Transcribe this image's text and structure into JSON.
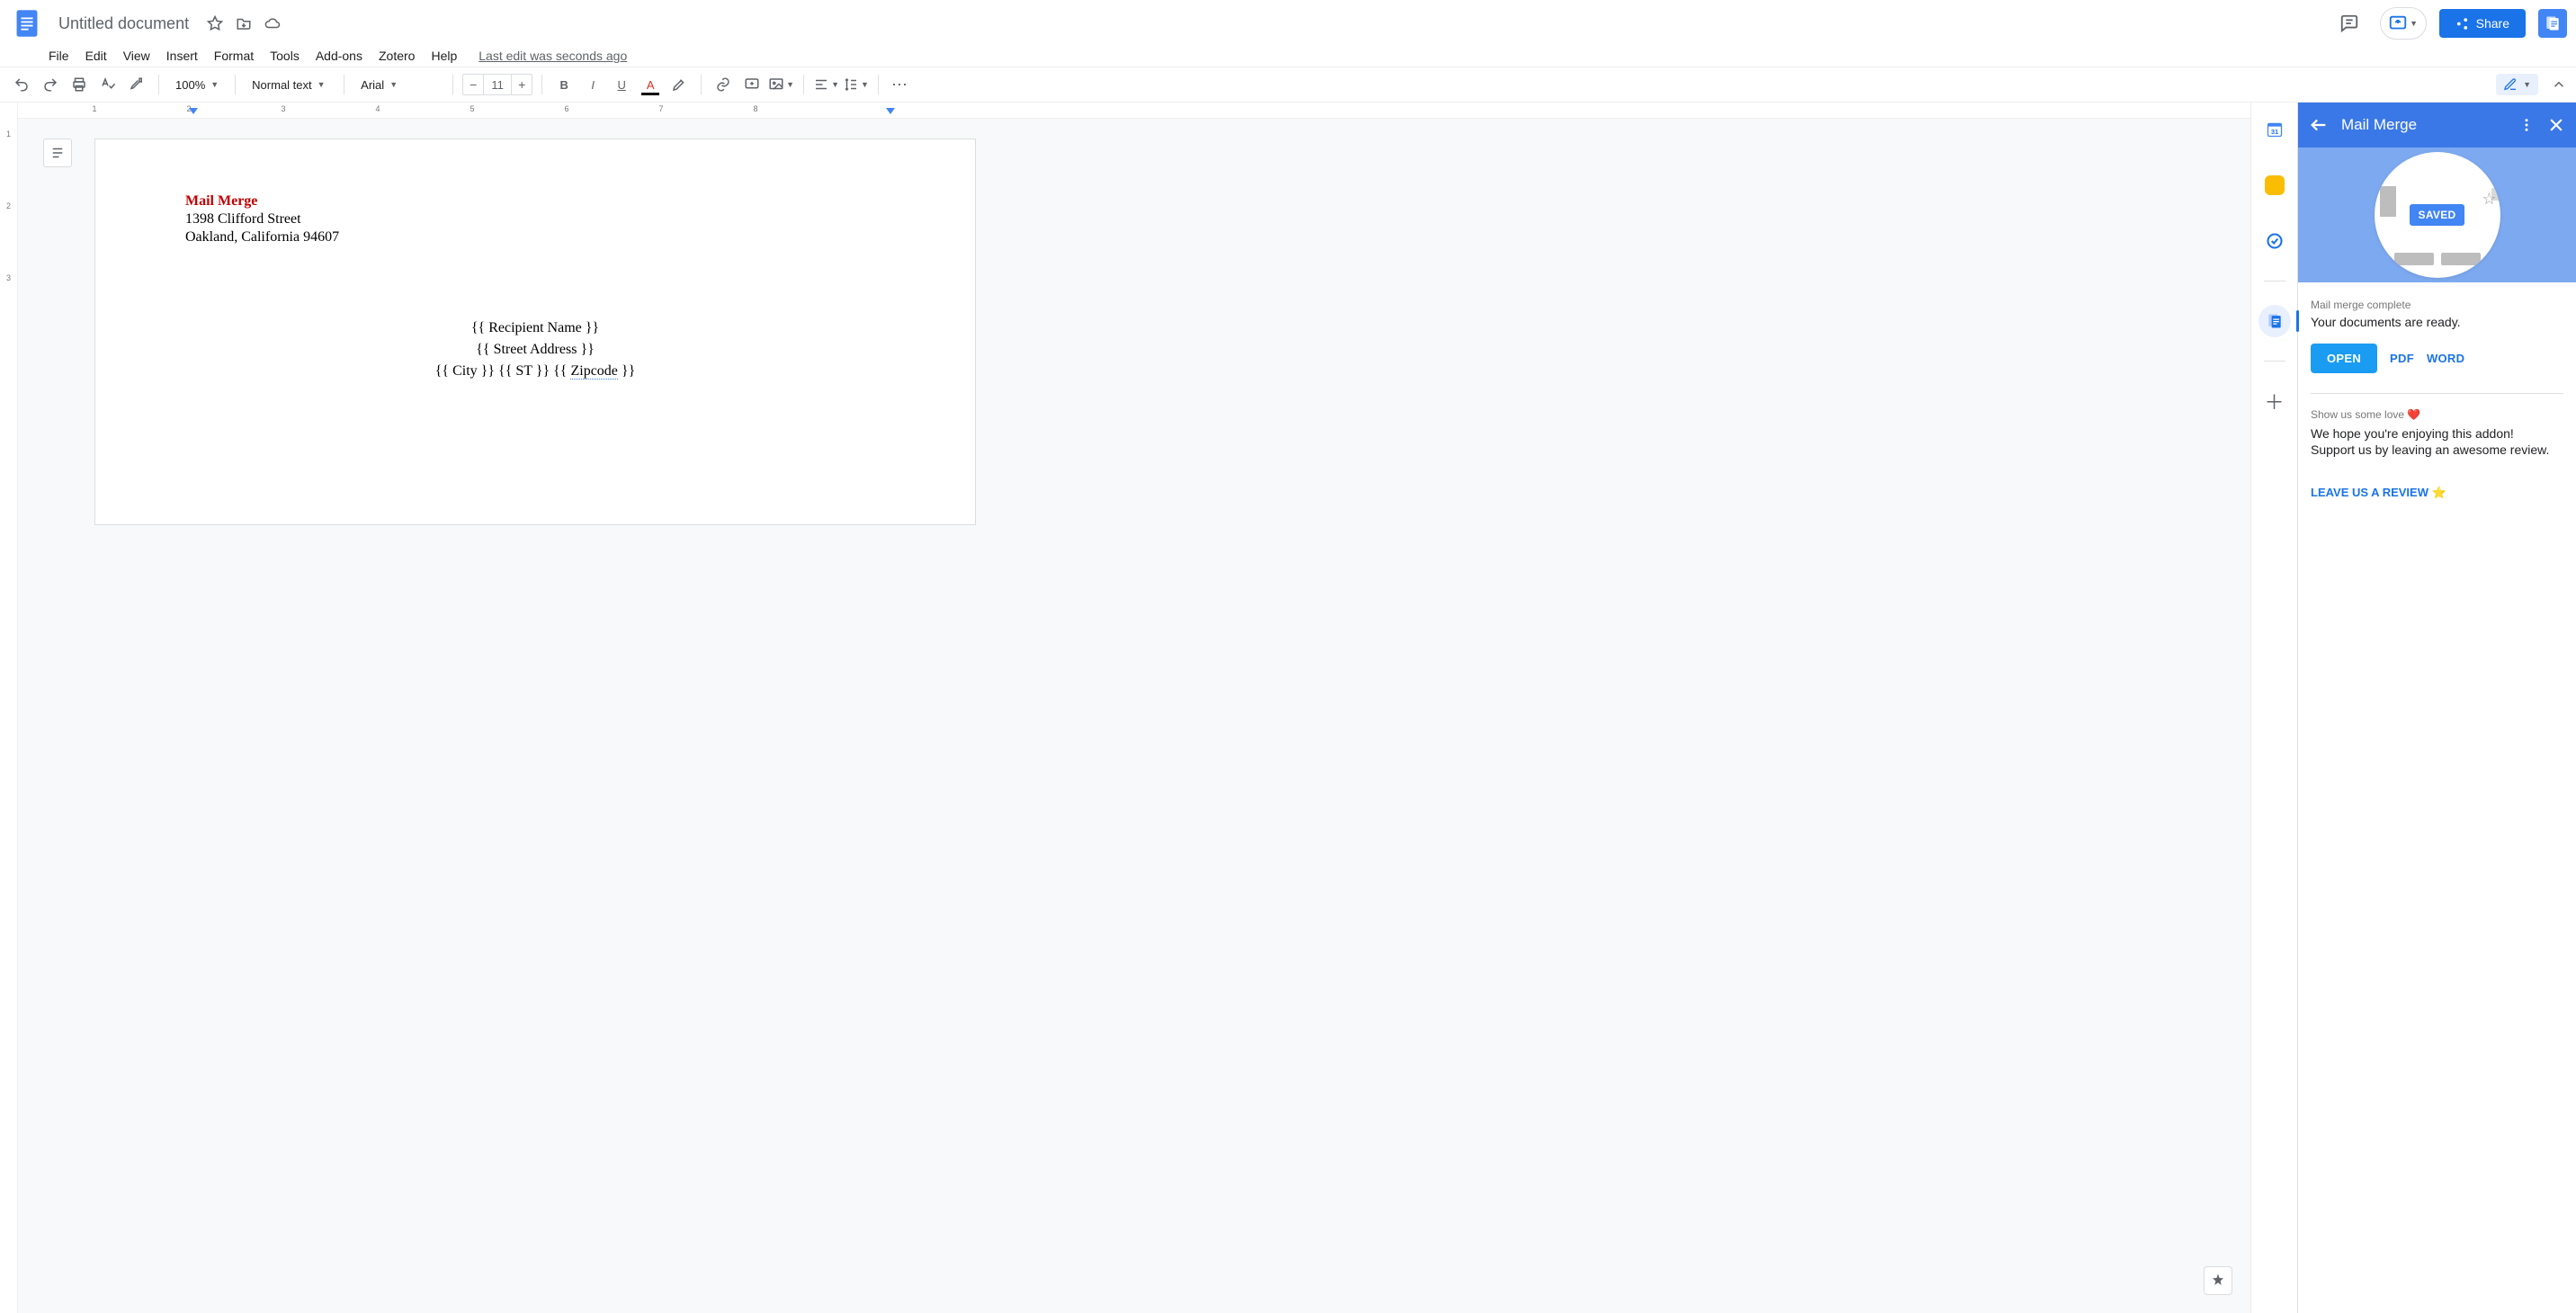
{
  "header": {
    "doc_title": "Untitled document",
    "menus": {
      "file": "File",
      "edit": "Edit",
      "view": "View",
      "insert": "Insert",
      "format": "Format",
      "tools": "Tools",
      "addons": "Add-ons",
      "zotero": "Zotero",
      "help": "Help"
    },
    "last_edit": "Last edit was seconds ago",
    "share_label": "Share"
  },
  "toolbar": {
    "zoom": "100%",
    "style": "Normal text",
    "font": "Arial",
    "font_size": "11",
    "more": "⋯"
  },
  "ruler": {
    "h_ticks": [
      "1",
      "2",
      "3",
      "4",
      "5",
      "6",
      "7",
      "8"
    ],
    "v_ticks": [
      "1",
      "2",
      "3"
    ]
  },
  "document": {
    "title": "Mail Merge",
    "addr1": "1398 Clifford Street",
    "addr2": "Oakland, California 94607",
    "center1": "{{ Recipient Name }}",
    "center2": "{{ Street Address }}",
    "center3a": "{{ City }} {{ ST }} {{ ",
    "center3_zip": "Zipcode",
    "center3b": " }}"
  },
  "addon": {
    "title": "Mail Merge",
    "hero_badge": "SAVED",
    "status_sub": "Mail merge complete",
    "status_msg": "Your documents are ready.",
    "open": "OPEN",
    "pdf": "PDF",
    "word": "WORD",
    "love_sub": "Show us some love ❤️",
    "love_msg1": "We hope you're enjoying this addon!",
    "love_msg2": "Support us by leaving an awesome review.",
    "review_link": "LEAVE US A REVIEW ⭐"
  }
}
